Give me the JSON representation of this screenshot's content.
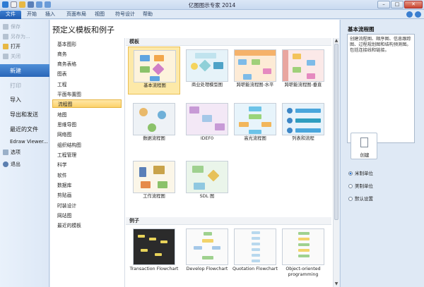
{
  "window": {
    "title": "亿图图示专家 2014",
    "buttons": [
      "–",
      "□",
      "✕"
    ]
  },
  "tabs": [
    "文件",
    "开始",
    "插入",
    "页面布局",
    "视图",
    "符号设计",
    "帮助"
  ],
  "leftnav": {
    "top_items": [
      {
        "label": "保存",
        "icon": "save-icon",
        "enabled": false
      },
      {
        "label": "另存为...",
        "icon": "save-as-icon",
        "enabled": false
      },
      {
        "label": "打开",
        "icon": "open-folder-icon",
        "enabled": true
      },
      {
        "label": "关闭",
        "icon": "close-doc-icon",
        "enabled": false
      }
    ],
    "new_label": "新建",
    "print_label": "打印",
    "import_label": "导入",
    "export_label": "导出和发送",
    "recent_label": "最近的文件",
    "viewer_label": "Edraw Viewer...",
    "options_label": "选项",
    "exit_label": "退出"
  },
  "main": {
    "heading": "预定义模板和例子",
    "categories": [
      "基本图形",
      "商务",
      "商务表格",
      "图表",
      "工程",
      "平面布置图",
      "流程图",
      "地图",
      "思维导图",
      "网络图",
      "组织结构图",
      "工程管理",
      "科学",
      "软件",
      "数据库",
      "剪贴画",
      "时装设计",
      "网站图",
      "最近的模板"
    ],
    "selected_category": "流程图",
    "templates_section": "模板",
    "templates": [
      "基本流程图",
      "商业处理模型图",
      "跨职能流程图-水平",
      "跨职能流程图-垂直",
      "数据流程图",
      "IDEF0",
      "高光流程图",
      "列表和流程",
      "工作流程图",
      "SDL 图"
    ],
    "examples_section": "例子",
    "examples": [
      "Transaction Flowchart",
      "Develop Flowchart",
      "Quotation Flowchart",
      "Object-oriented programming"
    ]
  },
  "right": {
    "title": "基本流程图",
    "description": "创建流程图、顺序图、信息跟踪图、过程规划图和结构预测图。包括连接线和链接。",
    "create_label": "创建",
    "units": [
      {
        "label": "米制单位",
        "selected": true
      },
      {
        "label": "美制单位",
        "selected": false
      },
      {
        "label": "默认设置",
        "selected": false
      }
    ]
  },
  "colors": {
    "accent": "#2a66b8",
    "selection": "#fcd26a"
  }
}
